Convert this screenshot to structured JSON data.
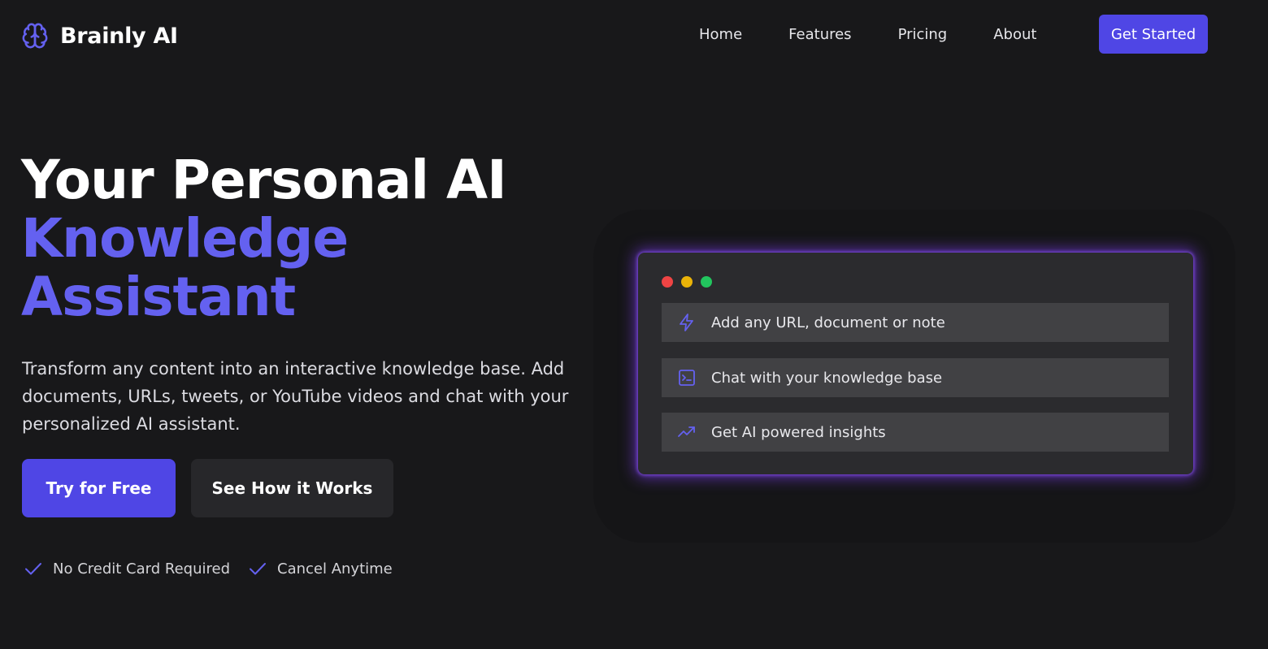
{
  "brand": {
    "name": "Brainly AI",
    "icon": "brain-icon",
    "icon_color": "#6461f0"
  },
  "nav": {
    "links": [
      "Home",
      "Features",
      "Pricing",
      "About"
    ],
    "cta_label": "Get Started",
    "cta_color": "#4f46e5"
  },
  "hero": {
    "title_line1": "Your Personal AI",
    "title_line2": "Knowledge",
    "title_line3": "Assistant",
    "accent_color": "#6461f0",
    "description": "Transform any content into an interactive knowledge base. Add documents, URLs, tweets, or YouTube videos and chat with your personalized AI assistant.",
    "primary_button": "Try for Free",
    "secondary_button": "See How it Works",
    "perks": [
      "No Credit Card Required",
      "Cancel Anytime"
    ],
    "perk_icon": "check-icon"
  },
  "demo_card": {
    "window_dot_colors": [
      "#ef4444",
      "#eab308",
      "#22c55e"
    ],
    "rows": [
      {
        "icon": "lightning-icon",
        "label": "Add any URL, document or note"
      },
      {
        "icon": "terminal-icon",
        "label": "Chat with your knowledge base"
      },
      {
        "icon": "trending-up-icon",
        "label": "Get AI powered insights"
      }
    ]
  }
}
